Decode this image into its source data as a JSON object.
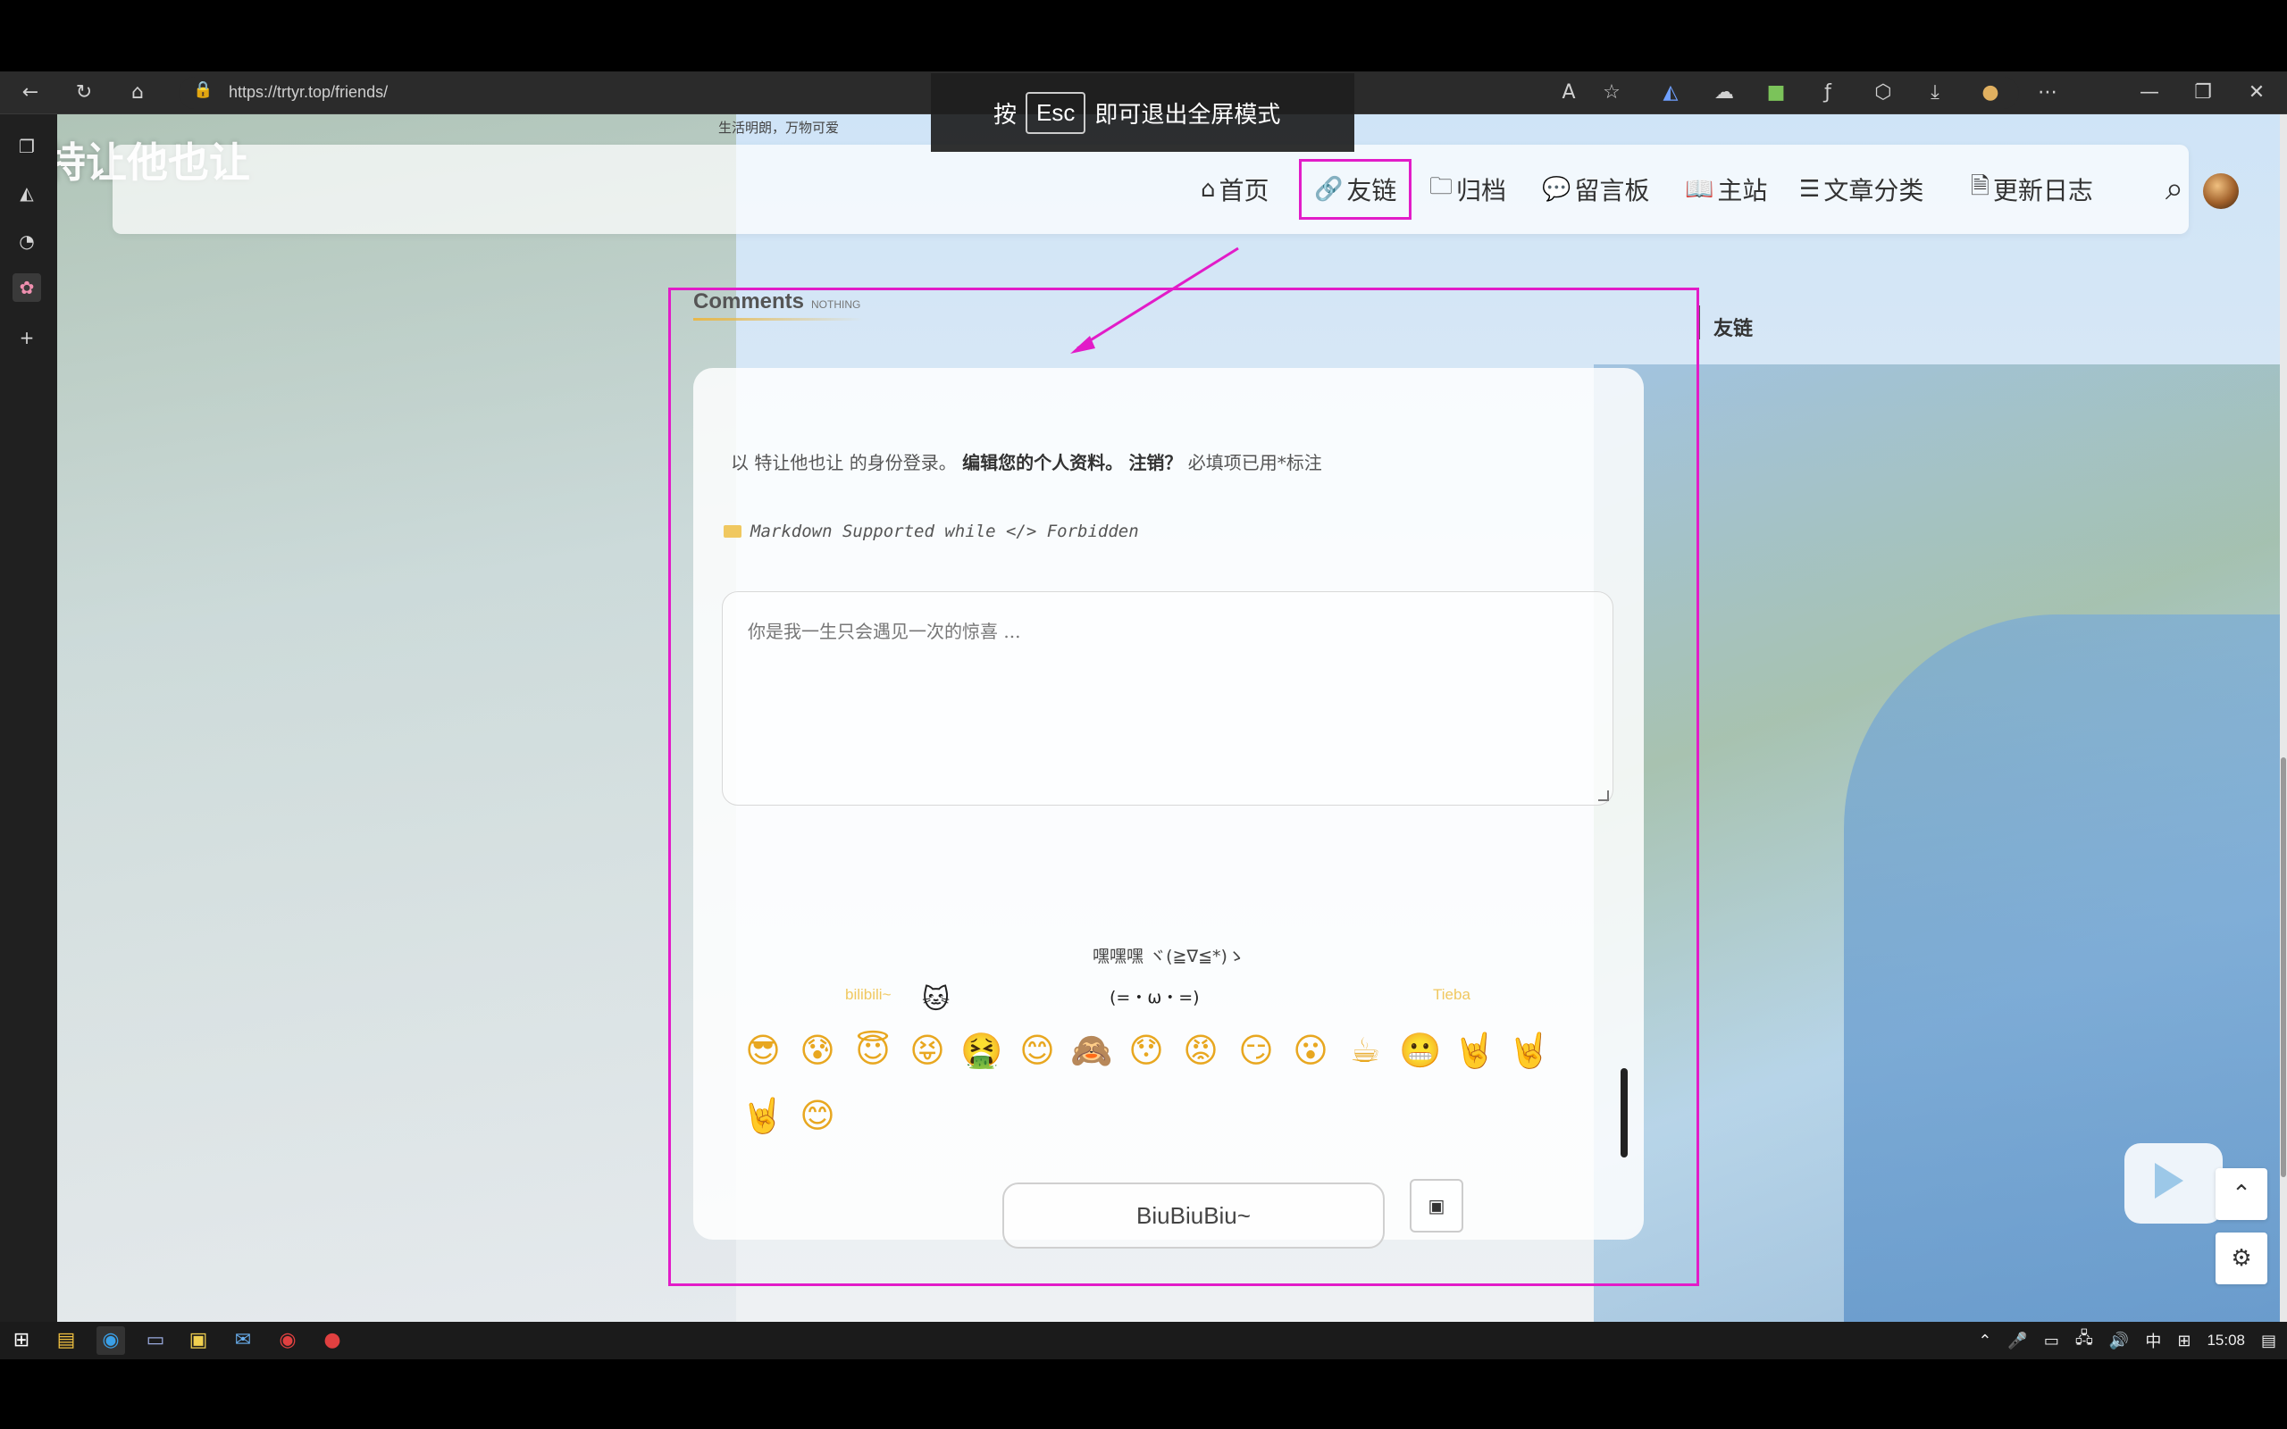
{
  "fullscreen_toast": {
    "prefix": "按",
    "key": "Esc",
    "suffix": "即可退出全屏模式"
  },
  "browser": {
    "url": "https://trtyr.top/friends/",
    "back_icon": "back-arrow-icon",
    "refresh_icon": "refresh-icon",
    "home_icon": "home-icon"
  },
  "site": {
    "title": "特让他也让",
    "subtitle": "生活明朗，万物可爱"
  },
  "nav": {
    "items": [
      {
        "icon": "⌂",
        "label": "首页"
      },
      {
        "icon": "🔗",
        "label": "友链"
      },
      {
        "icon": "🗀",
        "label": "归档"
      },
      {
        "icon": "💬",
        "label": "留言板"
      },
      {
        "icon": "📖",
        "label": "主站"
      },
      {
        "icon": "☰",
        "label": "文章分类"
      },
      {
        "icon": "🗎",
        "label": "更新日志"
      }
    ]
  },
  "sidebar_right": {
    "label": "友链"
  },
  "comments": {
    "title": "Comments",
    "tag": "NOTHING",
    "login_prefix": "以 特让他也让 的身份登录。",
    "edit_profile": "编辑您的个人资料。",
    "logout": "注销？",
    "required_note": "必填项已用*标注",
    "markdown_note": "Markdown Supported while </> Forbidden",
    "placeholder": "你是我一生只会遇见一次的惊喜 ...",
    "kaomoji_toggle": "嘿嘿嘿 ヾ(≧∇≦*)ゝ",
    "tabs": {
      "bilibili": "bilibili~",
      "kaomoji": "(=・ω・=)",
      "tieba": "Tieba"
    },
    "emojis": [
      "😎",
      "😰",
      "😇",
      "😝",
      "🤮",
      "😊",
      "🙈",
      "😯",
      "😡",
      "😏",
      "😮",
      "☕",
      "😬",
      "🤘",
      "🤘",
      "🤘",
      "😊"
    ],
    "submit_label": "BiuBiuBiu~",
    "image_icon": "image-icon"
  },
  "widgets": {
    "scroll_top": "⌃",
    "settings": "⚙"
  },
  "taskbar": {
    "clock": "15:08",
    "ime": "中"
  }
}
